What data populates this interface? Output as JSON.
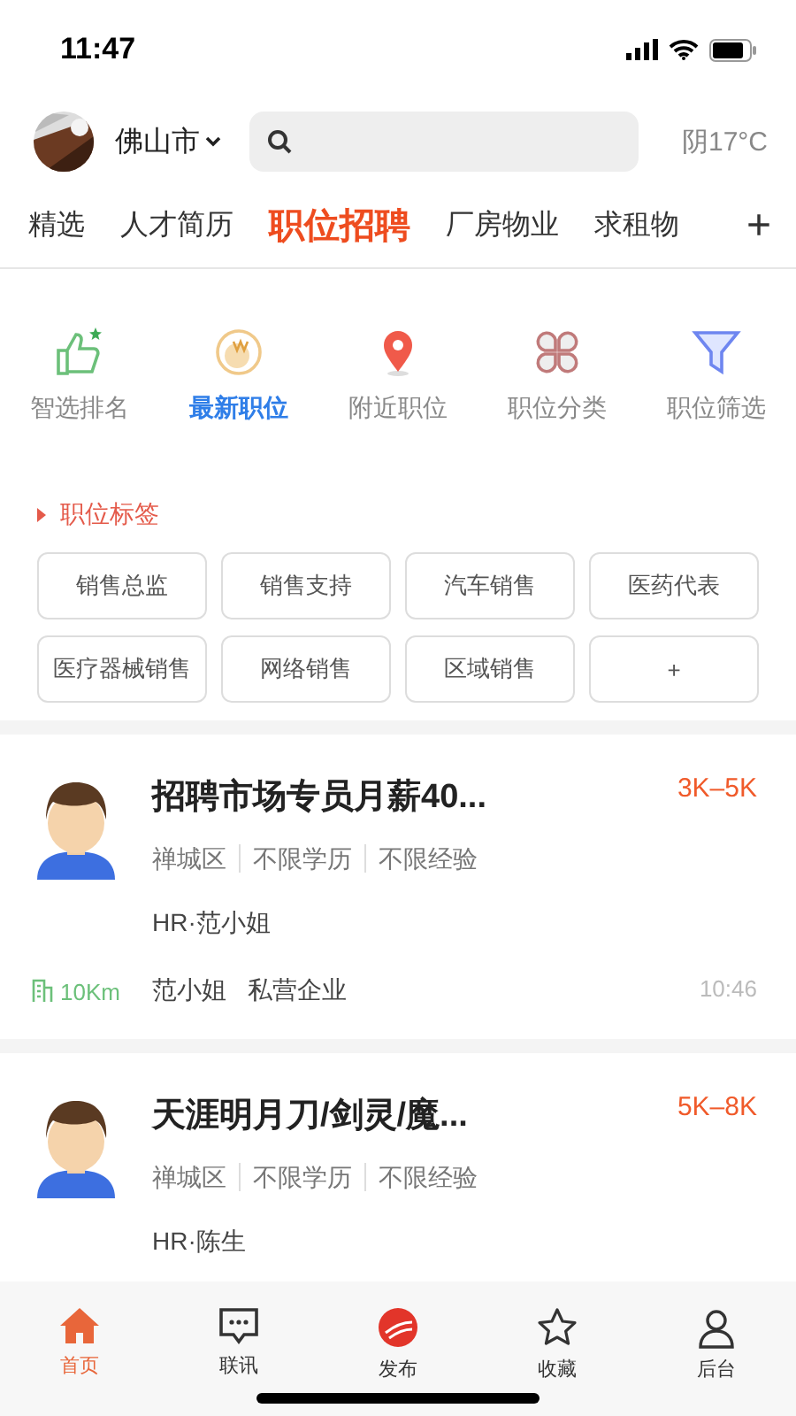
{
  "status_bar": {
    "time": "11:47"
  },
  "header": {
    "city": "佛山市",
    "weather": "阴17°C"
  },
  "tabs": [
    {
      "label": "精选",
      "selected": false
    },
    {
      "label": "人才简历",
      "selected": false
    },
    {
      "label": "职位招聘",
      "selected": true
    },
    {
      "label": "厂房物业",
      "selected": false
    },
    {
      "label": "求租物",
      "selected": false
    }
  ],
  "add_tab": "+",
  "quick_nav": [
    {
      "label": "智选排名",
      "selected": false
    },
    {
      "label": "最新职位",
      "selected": true
    },
    {
      "label": "附近职位",
      "selected": false
    },
    {
      "label": "职位分类",
      "selected": false
    },
    {
      "label": "职位筛选",
      "selected": false
    }
  ],
  "tag_section": {
    "title": "职位标签",
    "tags": [
      "销售总监",
      "销售支持",
      "汽车销售",
      "医药代表",
      "医疗器械销售",
      "网络销售",
      "区域销售"
    ],
    "more": "+"
  },
  "jobs": [
    {
      "title": "招聘市场专员月薪40...",
      "salary": "3K–5K",
      "tags": [
        "禅城区",
        "不限学历",
        "不限经验"
      ],
      "hr": "HR·范小姐",
      "distance": "10Km",
      "contact": "范小姐",
      "company_type": "私营企业",
      "time": "10:46"
    },
    {
      "title": "天涯明月刀/剑灵/魔...",
      "salary": "5K–8K",
      "tags": [
        "禅城区",
        "不限学历",
        "不限经验"
      ],
      "hr": "HR·陈生"
    }
  ],
  "bottom_nav": [
    {
      "label": "首页",
      "selected": true
    },
    {
      "label": "联讯",
      "selected": false
    },
    {
      "label": "发布",
      "selected": false
    },
    {
      "label": "收藏",
      "selected": false
    },
    {
      "label": "后台",
      "selected": false
    }
  ]
}
